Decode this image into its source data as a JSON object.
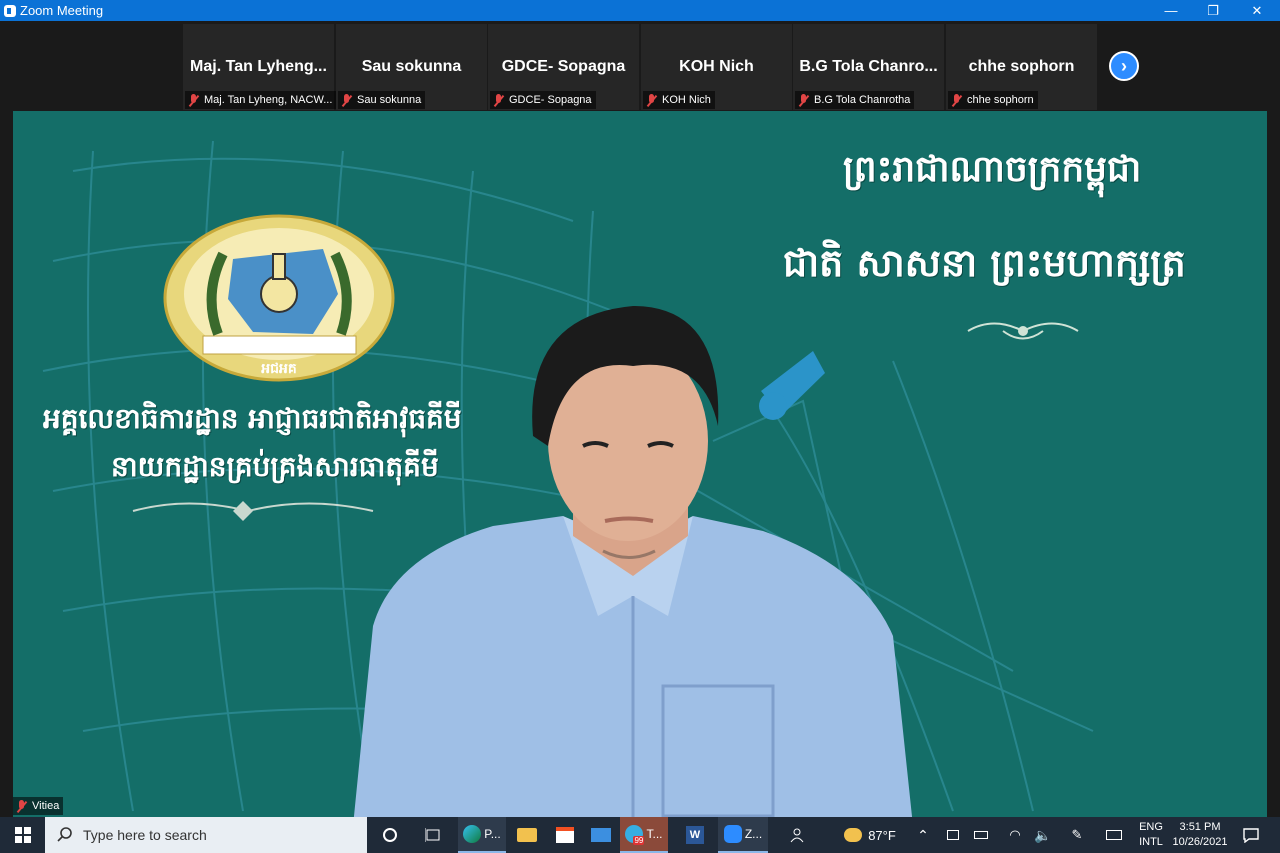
{
  "window": {
    "title": "Zoom Meeting",
    "minimize": "—",
    "restore": "❐",
    "close": "✕"
  },
  "participants": [
    {
      "name": "Maj. Tan Lyheng...",
      "label": "Maj. Tan Lyheng, NACW..."
    },
    {
      "name": "Sau sokunna",
      "label": "Sau sokunna"
    },
    {
      "name": "GDCE- Sopagna",
      "label": "GDCE- Sopagna"
    },
    {
      "name": "KOH Nich",
      "label": "KOH Nich"
    },
    {
      "name": "B.G Tola Chanro...",
      "label": "B.G Tola Chanrotha"
    },
    {
      "name": "chhe sophorn",
      "label": "chhe sophorn"
    }
  ],
  "next_arrow": "›",
  "main_video": {
    "speaker_label": "Vitiea",
    "khmer_right_line1": "ព្រះរាជាណាចក្រកម្ពុជា",
    "khmer_right_line2": "ជាតិ  សាសនា  ព្រះមហាក្សត្រ",
    "khmer_left_line1": "អគ្គលេខាធិការដ្ឋាន អាជ្ញាធរជាតិអាវុធគីមី",
    "khmer_left_line2": "នាយកដ្ឋានគ្រប់គ្រងសារធាតុគីមី",
    "emblem_text": "អជអគ"
  },
  "taskbar": {
    "search_placeholder": "Type here to search",
    "apps": [
      {
        "icon": "edge-icon",
        "label": "P..."
      },
      {
        "icon": "telegram-icon",
        "label": "T...",
        "badge": "99"
      },
      {
        "icon": "zoom-icon",
        "label": "Z..."
      }
    ],
    "weather": "87°F",
    "lang_line1": "ENG",
    "lang_line2": "INTL",
    "time": "3:51 PM",
    "date": "10/26/2021"
  },
  "colors": {
    "titlebar": "#0b72d6",
    "video_bg": "#146e68",
    "taskbar": "#1f2a38",
    "muted_mic": "#e04545",
    "accent": "#2d8cff"
  }
}
